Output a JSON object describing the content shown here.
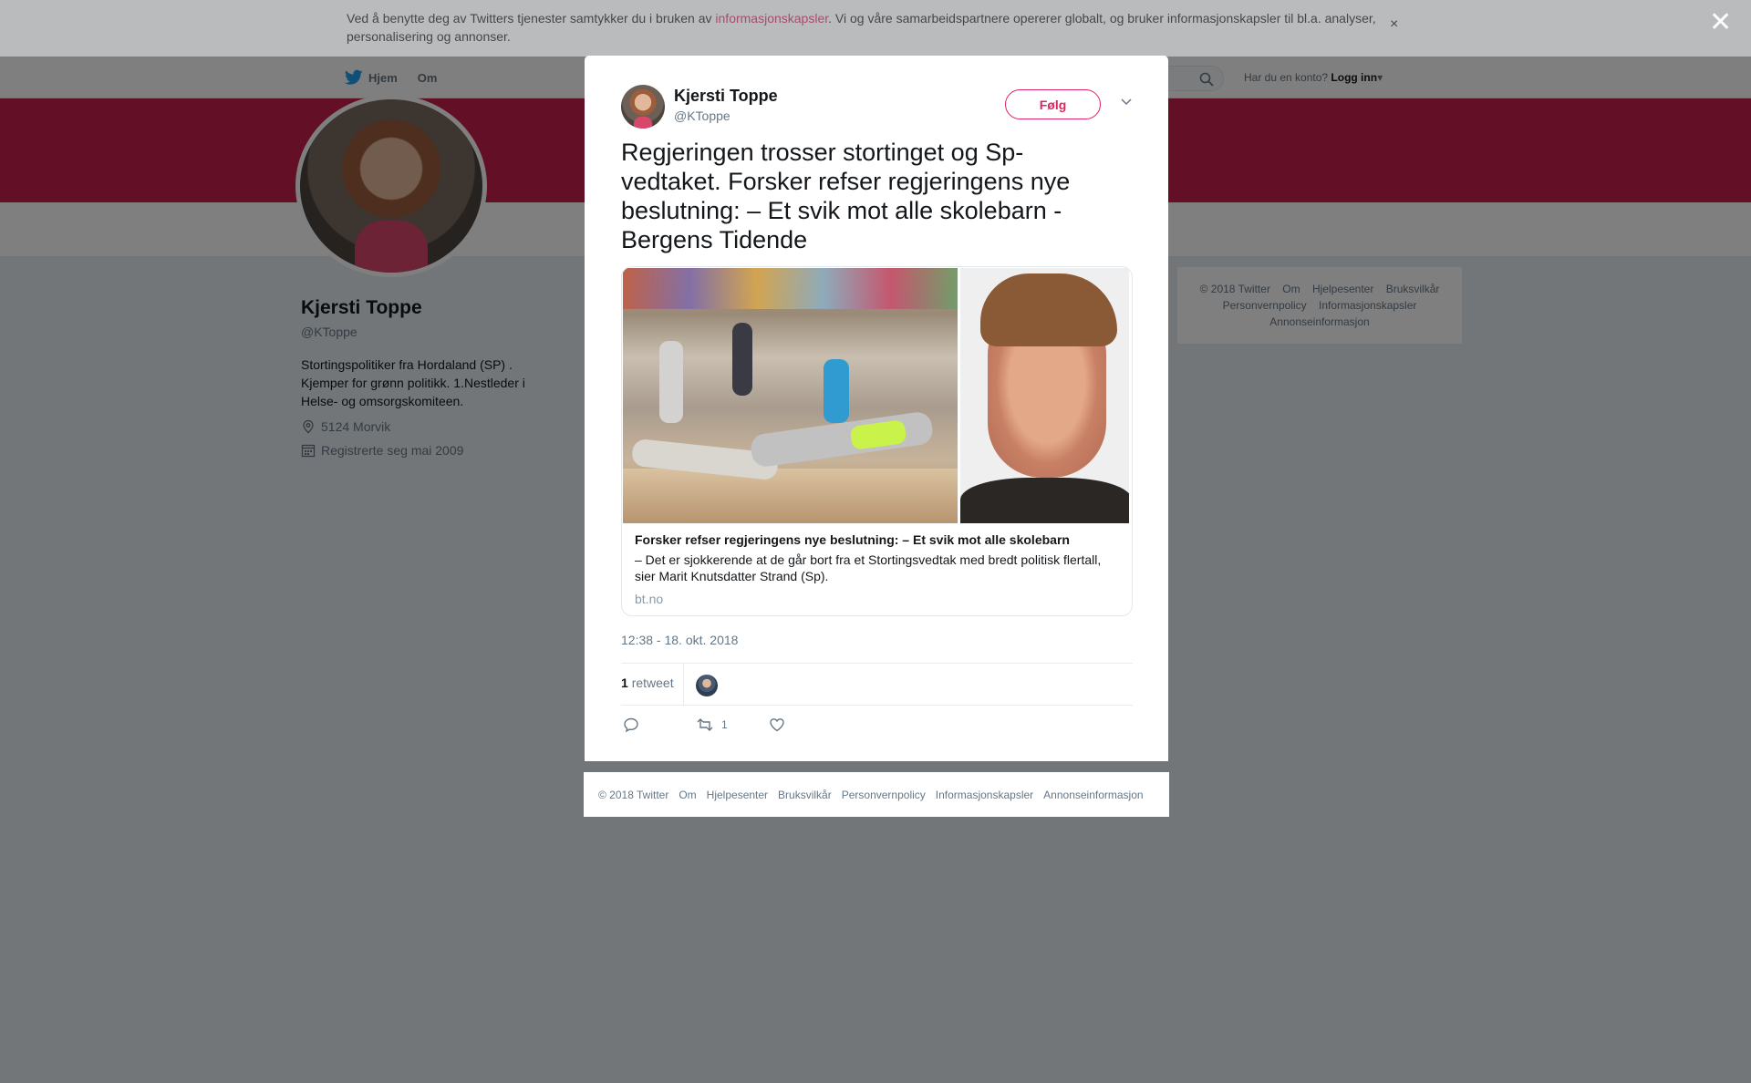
{
  "cookie_bar": {
    "text_before": "Ved å benytte deg av Twitters tjenester samtykker du i bruken av ",
    "link": "informasjonskapsler",
    "text_after": ". Vi og våre samarbeidspartnere opererer globalt, og bruker informasjonskapsler til bl.a. analyser, personalisering og annonser.",
    "close": "×"
  },
  "overlay_close": "✕",
  "nav": {
    "home": "Hjem",
    "about": "Om",
    "account_prompt": "Har du en konto?",
    "login": "Logg inn"
  },
  "profile": {
    "name": "Kjersti Toppe",
    "handle": "@KToppe",
    "bio": "Stortingspolitiker fra Hordaland (SP) . Kjemper for grønn politikk. 1.Nestleder i Helse- og omsorgskomiteen.",
    "location": "5124 Morvik",
    "joined": "Registrerte seg mai 2009"
  },
  "right_footer": {
    "line1": [
      "© 2018 Twitter",
      "Om",
      "Hjelpesenter",
      "Bruksvilkår"
    ],
    "line2": [
      "Personvernpolicy",
      "Informasjonskapsler"
    ],
    "line3": [
      "Annonseinformasjon"
    ]
  },
  "tweet": {
    "author_name": "Kjersti Toppe",
    "author_handle": "@KToppe",
    "follow_label": "Følg",
    "text": "Regjeringen trosser stortinget og Sp-vedtaket. Forsker refser regjeringens nye beslutning: – Et svik mot alle skolebarn - Bergens Tidende",
    "card": {
      "title": "Forsker refser regjeringens nye beslutning: – Et svik mot alle skolebarn",
      "description": "– Det er sjokkerende at de går bort fra et Stortingsvedtak med bredt politisk flertall, sier Marit Knutsdatter Strand (Sp).",
      "domain": "bt.no"
    },
    "timestamp": "12:38 - 18. okt. 2018",
    "retweet_count": "1",
    "retweet_label": "retweet",
    "action_retweet_count": "1"
  },
  "modal_footer": [
    "© 2018 Twitter",
    "Om",
    "Hjelpesenter",
    "Bruksvilkår",
    "Personvernpolicy",
    "Informasjonskapsler",
    "Annonseinformasjon"
  ],
  "colors": {
    "banner": "#c7204e",
    "accent": "#e0245e",
    "twitter_blue": "#1da1f2"
  }
}
